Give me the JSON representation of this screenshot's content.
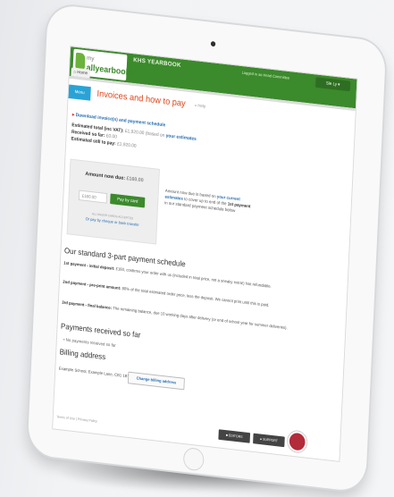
{
  "header": {
    "logo_small": "my",
    "logo_text": "allyearbooks",
    "app_title": "KHS YEARBOOK",
    "top_link": "Logged in as Head Committee",
    "user_label": "Sie Ly ▾",
    "home_label": "Home"
  },
  "page": {
    "menu_label": "Menu",
    "title": "Invoices and how to pay",
    "help_text": "» Help"
  },
  "invoices": {
    "download_label": "Download invoice(s) and payment schedule",
    "estimated_total_label": "Estimated total (inc VAT):",
    "estimated_total_value": "£1,920.00",
    "estimated_total_suffix": "(based on",
    "estimated_total_link": "your estimates",
    "received_label": "Received so far:",
    "received_value": "£0.00",
    "still_label": "Estimated still to pay:",
    "still_value": "£1,920.00"
  },
  "payment": {
    "amount_due_label": "Amount now due:",
    "amount_due_value": "£160.00",
    "input_value": "£160.00",
    "pay_card_label": "Pay by card",
    "accepted_cards": "ALL MAJOR CARDS ACCEPTED",
    "cheque_link": "Or pay by cheque or bank transfer",
    "explanation_prefix": "Amount now due is based on",
    "explanation_link": "your current estimates",
    "explanation_mid": "to cover up to end of the",
    "explanation_bold": "1st payment",
    "explanation_suffix": "in our standard payment schedule below"
  },
  "schedule": {
    "heading": "Our standard 3-part payment schedule",
    "items": [
      {
        "label": "1st payment - initial deposit:",
        "text": "£160, confirms your order with us (included in total price, not a sneaky extra!) Not refundable."
      },
      {
        "label": "2nd payment - pre-print amount:",
        "text": "80% of the total estimated order price, less the deposit. We cannot print until this is paid."
      },
      {
        "label": "3rd payment - final balance:",
        "text": "The remaining balance, due 10 working days after delivery (or end of school year for summer deliveries)."
      }
    ]
  },
  "payments_received": {
    "heading": "Payments received so far",
    "empty_text": "No payments received so far"
  },
  "billing": {
    "heading": "Billing address",
    "address": "Example School, Example Lane, CB1 1BY",
    "change_label": "Change billing address"
  },
  "footer": {
    "terms": "Terms of Use | Privacy Policy",
    "editors_label": "EDITORS",
    "support_label": "SUPPORT"
  }
}
